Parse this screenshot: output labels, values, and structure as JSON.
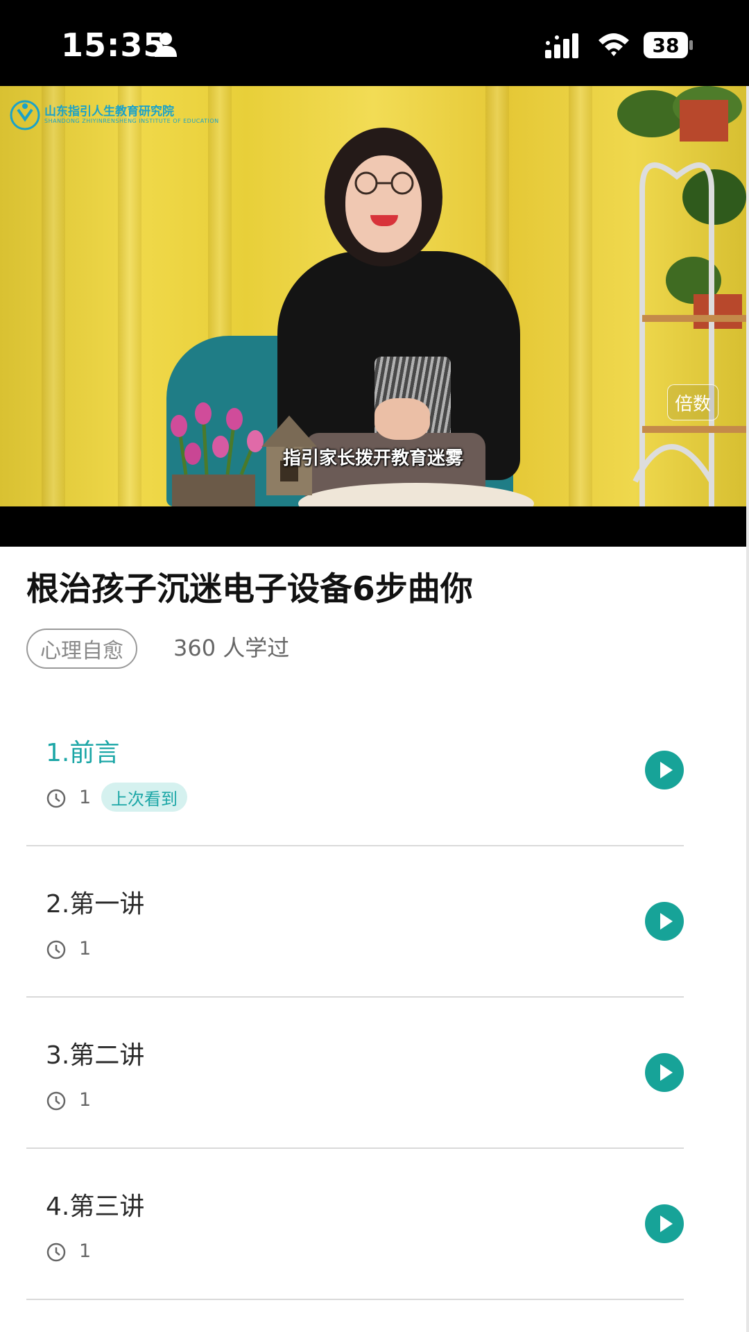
{
  "status_bar": {
    "time": "15:35",
    "battery": "38"
  },
  "video": {
    "logo_text": "山东指引人生教育研究院",
    "logo_sub": "SHANDONG ZHIYINRENSHENG INSTITUTE OF EDUCATION",
    "subtitle": "指引家长拨开教育迷雾",
    "speed_label": "倍数"
  },
  "course": {
    "title": "根治孩子沉迷电子设备6步曲你",
    "category": "心理自愈",
    "learners": "360 人学过"
  },
  "lessons": [
    {
      "title": "1.前言",
      "duration": "1",
      "badge": "上次看到",
      "active": true
    },
    {
      "title": "2.第一讲",
      "duration": "1"
    },
    {
      "title": "3.第二讲",
      "duration": "1"
    },
    {
      "title": "4.第三讲",
      "duration": "1"
    }
  ],
  "colors": {
    "accent": "#1ba6a6",
    "badge_bg": "#d5f1ef"
  },
  "icons": [
    "person-icon",
    "signal-icon",
    "wifi-icon",
    "clock-icon",
    "play-icon"
  ]
}
